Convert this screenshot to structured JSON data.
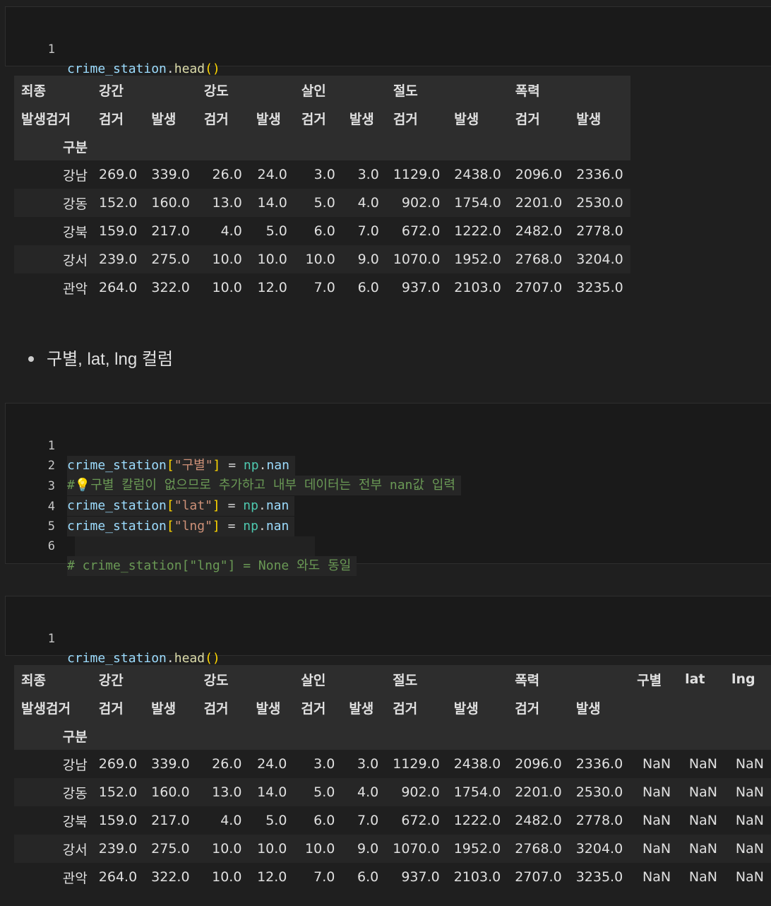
{
  "cells": {
    "cell1": {
      "line_no": "1",
      "code": {
        "obj": "crime_station",
        "dot": ".",
        "fn": "head",
        "parens": "()"
      }
    },
    "cell2": {
      "lines": [
        {
          "no": "1"
        },
        {
          "no": "2"
        },
        {
          "no": "3"
        },
        {
          "no": "4"
        },
        {
          "no": "5"
        },
        {
          "no": "6"
        }
      ],
      "l1": {
        "obj": "crime_station",
        "lb": "[",
        "str": "\"구별\"",
        "rb": "]",
        "eq": " = ",
        "mod": "np",
        "dot": ".",
        "attr": "nan"
      },
      "l2": {
        "hash": "#",
        "text": "구별 칼럼이 없으므로 추가하고 내부 데이터는 전부 nan값 입력"
      },
      "l3": {
        "obj": "crime_station",
        "lb": "[",
        "str": "\"lat\"",
        "rb": "]",
        "eq": " = ",
        "mod": "np",
        "dot": ".",
        "attr": "nan"
      },
      "l4": {
        "obj": "crime_station",
        "lb": "[",
        "str": "\"lng\"",
        "rb": "]",
        "eq": " = ",
        "mod": "np",
        "dot": ".",
        "attr": "nan"
      },
      "l6": {
        "text": "# crime_station[\"lng\"] = None 와도 동일"
      }
    },
    "cell3": {
      "line_no": "1",
      "code": {
        "obj": "crime_station",
        "dot": ".",
        "fn": "head",
        "parens": "()"
      }
    }
  },
  "markdown": {
    "bullet": "구별, lat, lng 컬럼"
  },
  "table1": {
    "h1": [
      "죄종",
      "강간",
      "",
      "강도",
      "",
      "살인",
      "",
      "절도",
      "",
      "폭력",
      ""
    ],
    "h2": [
      "발생검거",
      "검거",
      "발생",
      "검거",
      "발생",
      "검거",
      "발생",
      "검거",
      "발생",
      "검거",
      "발생"
    ],
    "h3": [
      "구분"
    ],
    "rows": [
      [
        "강남",
        "269.0",
        "339.0",
        "26.0",
        "24.0",
        "3.0",
        "3.0",
        "1129.0",
        "2438.0",
        "2096.0",
        "2336.0"
      ],
      [
        "강동",
        "152.0",
        "160.0",
        "13.0",
        "14.0",
        "5.0",
        "4.0",
        "902.0",
        "1754.0",
        "2201.0",
        "2530.0"
      ],
      [
        "강북",
        "159.0",
        "217.0",
        "4.0",
        "5.0",
        "6.0",
        "7.0",
        "672.0",
        "1222.0",
        "2482.0",
        "2778.0"
      ],
      [
        "강서",
        "239.0",
        "275.0",
        "10.0",
        "10.0",
        "10.0",
        "9.0",
        "1070.0",
        "1952.0",
        "2768.0",
        "3204.0"
      ],
      [
        "관악",
        "264.0",
        "322.0",
        "10.0",
        "12.0",
        "7.0",
        "6.0",
        "937.0",
        "2103.0",
        "2707.0",
        "3235.0"
      ]
    ]
  },
  "table2": {
    "h1": [
      "죄종",
      "강간",
      "",
      "강도",
      "",
      "살인",
      "",
      "절도",
      "",
      "폭력",
      "",
      "구별",
      "lat",
      "lng"
    ],
    "h2": [
      "발생검거",
      "검거",
      "발생",
      "검거",
      "발생",
      "검거",
      "발생",
      "검거",
      "발생",
      "검거",
      "발생",
      "",
      "",
      ""
    ],
    "h3": [
      "구분"
    ],
    "rows": [
      [
        "강남",
        "269.0",
        "339.0",
        "26.0",
        "24.0",
        "3.0",
        "3.0",
        "1129.0",
        "2438.0",
        "2096.0",
        "2336.0",
        "NaN",
        "NaN",
        "NaN"
      ],
      [
        "강동",
        "152.0",
        "160.0",
        "13.0",
        "14.0",
        "5.0",
        "4.0",
        "902.0",
        "1754.0",
        "2201.0",
        "2530.0",
        "NaN",
        "NaN",
        "NaN"
      ],
      [
        "강북",
        "159.0",
        "217.0",
        "4.0",
        "5.0",
        "6.0",
        "7.0",
        "672.0",
        "1222.0",
        "2482.0",
        "2778.0",
        "NaN",
        "NaN",
        "NaN"
      ],
      [
        "강서",
        "239.0",
        "275.0",
        "10.0",
        "10.0",
        "10.0",
        "9.0",
        "1070.0",
        "1952.0",
        "2768.0",
        "3204.0",
        "NaN",
        "NaN",
        "NaN"
      ],
      [
        "관악",
        "264.0",
        "322.0",
        "10.0",
        "12.0",
        "7.0",
        "6.0",
        "937.0",
        "2103.0",
        "2707.0",
        "3235.0",
        "NaN",
        "NaN",
        "NaN"
      ]
    ]
  },
  "colors": {
    "background": "#1f1f1f",
    "cell_bg": "#1a1a1a",
    "variable": "#9cdcfe",
    "function": "#dcdcaa",
    "string": "#ce9178",
    "comment": "#6a9955"
  },
  "icons": {
    "comment_marker": "lightbulb-icon"
  }
}
